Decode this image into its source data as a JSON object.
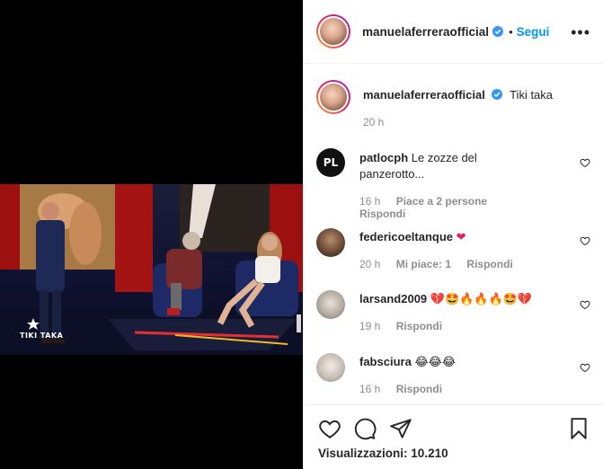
{
  "header": {
    "username": "manuelaferreraofficial",
    "follow_label": "Segui",
    "more_label": "•••"
  },
  "caption": {
    "username": "manuelaferreraofficial",
    "text": "Tiki taka",
    "time": "20 h"
  },
  "video": {
    "logo_text": "TIKI TAKA"
  },
  "comments": [
    {
      "username": "patlocph",
      "avatar_text": "PL",
      "text": "Le zozze del panzerotto...",
      "time": "16 h",
      "likes": "Piace a 2 persone",
      "reply": "Rispondi"
    },
    {
      "username": "federicoeltanque",
      "text": "❤",
      "time": "20 h",
      "likes": "Mi piace: 1",
      "reply": "Rispondi"
    },
    {
      "username": "larsand2009",
      "text": "💔🤩🔥🔥🔥🤩💔",
      "time": "19 h",
      "likes": "",
      "reply": "Rispondi"
    },
    {
      "username": "fabsciura",
      "text": "😂😂😂",
      "time": "16 h",
      "likes": "",
      "reply": "Rispondi"
    }
  ],
  "footer": {
    "views_label": "Visualizzazioni:",
    "views_count": "10.210"
  },
  "icons": [
    "heart-icon",
    "comment-icon",
    "share-icon",
    "bookmark-icon",
    "verified-icon",
    "more-icon"
  ],
  "colors": {
    "link_blue": "#0095f6",
    "verified": "#3897f0",
    "muted": "#8e8e8e",
    "text": "#262626"
  }
}
